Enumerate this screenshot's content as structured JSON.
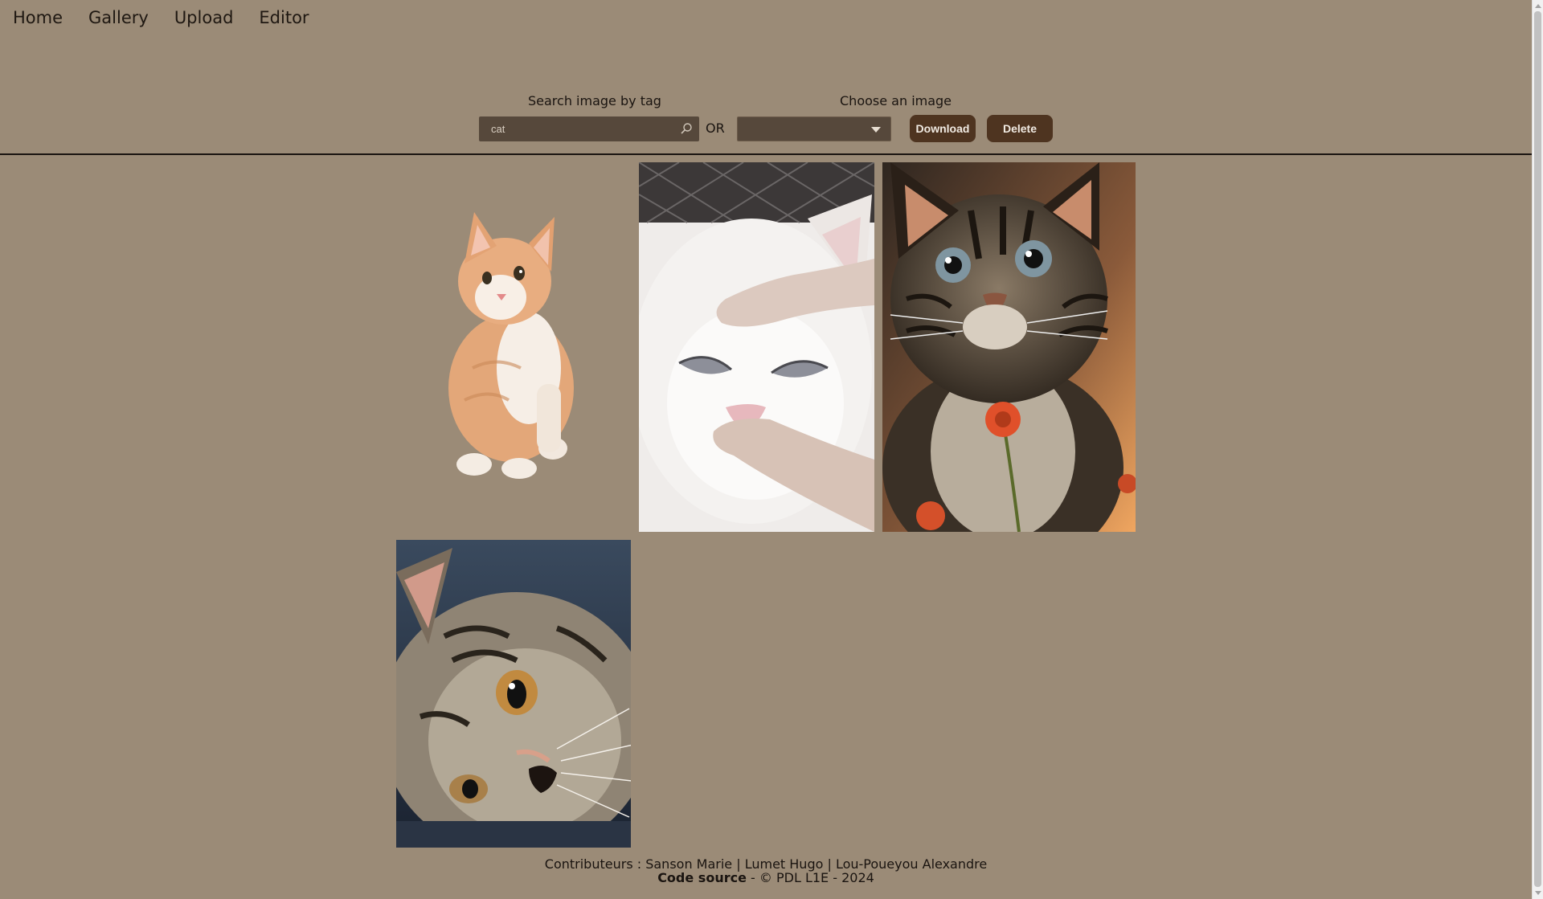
{
  "nav": {
    "items": [
      "Home",
      "Gallery",
      "Upload",
      "Editor"
    ]
  },
  "toolbar": {
    "search_label": "Search image by tag",
    "search_value": "cat",
    "or_text": "OR",
    "choose_label": "Choose an image",
    "select_value": "",
    "download_label": "Download",
    "delete_label": "Delete"
  },
  "gallery": {
    "images": [
      {
        "subject": "orange-white-kitten"
      },
      {
        "subject": "white-cat-being-petted"
      },
      {
        "subject": "tabby-cat-with-flower"
      },
      {
        "subject": "tabby-cat-lying"
      }
    ]
  },
  "footer": {
    "contributors": "Contributeurs : Sanson Marie | Lumet Hugo | Lou-Poueyou Alexandre",
    "source_link": "Code source",
    "copyright": " - © PDL L1E - 2024"
  },
  "colors": {
    "background": "#9b8b77",
    "input_bg": "#56483b",
    "button_bg": "#4e3420"
  }
}
